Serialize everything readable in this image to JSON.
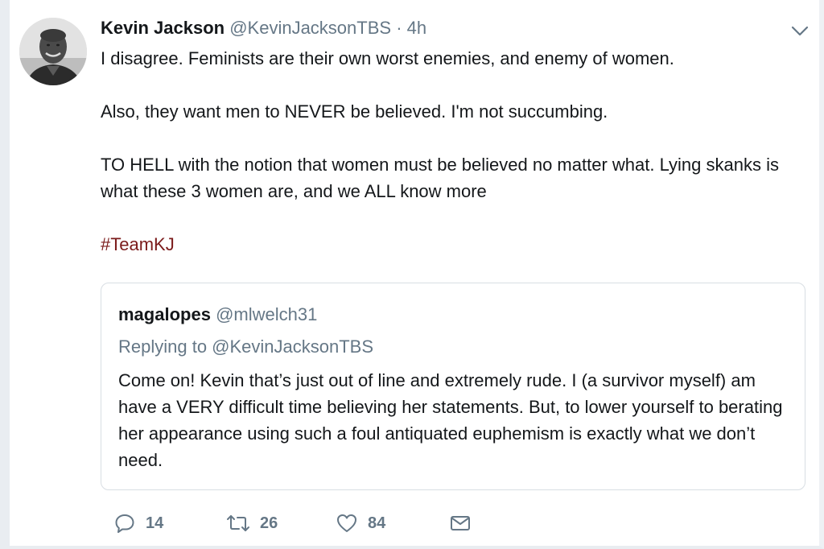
{
  "tweet": {
    "author_name": "Kevin Jackson",
    "author_handle": "@KevinJacksonTBS",
    "separator": "·",
    "time": "4h",
    "paragraphs": [
      "I disagree. Feminists are their own worst enemies, and enemy of women.",
      "Also, they want men to NEVER be believed. I'm not succumbing.",
      "TO HELL with the notion that women must be believed no matter what. Lying skanks is what these 3 women are, and we ALL know more"
    ],
    "hashtag": "#TeamKJ",
    "avatar_icon": "profile-photo",
    "menu_icon": "chevron-down-icon"
  },
  "quoted_tweet": {
    "author_name": "magalopes",
    "author_handle": "@mlwelch31",
    "replying_to": "Replying to @KevinJacksonTBS",
    "text": "Come on! Kevin that’s just out of line and extremely rude. I (a survivor myself) am have a VERY difficult time believing her statements. But, to lower yourself to berating her appearance using such a foul antiquated euphemism is exactly what we don’t need."
  },
  "actions": {
    "reply_count": "14",
    "retweet_count": "26",
    "like_count": "84",
    "icons": [
      "reply-icon",
      "retweet-icon",
      "like-icon",
      "message-icon"
    ]
  },
  "colors": {
    "text": "#14171a",
    "muted": "#657786",
    "hashtag": "#7b1b1b",
    "border": "#d8dee3"
  }
}
